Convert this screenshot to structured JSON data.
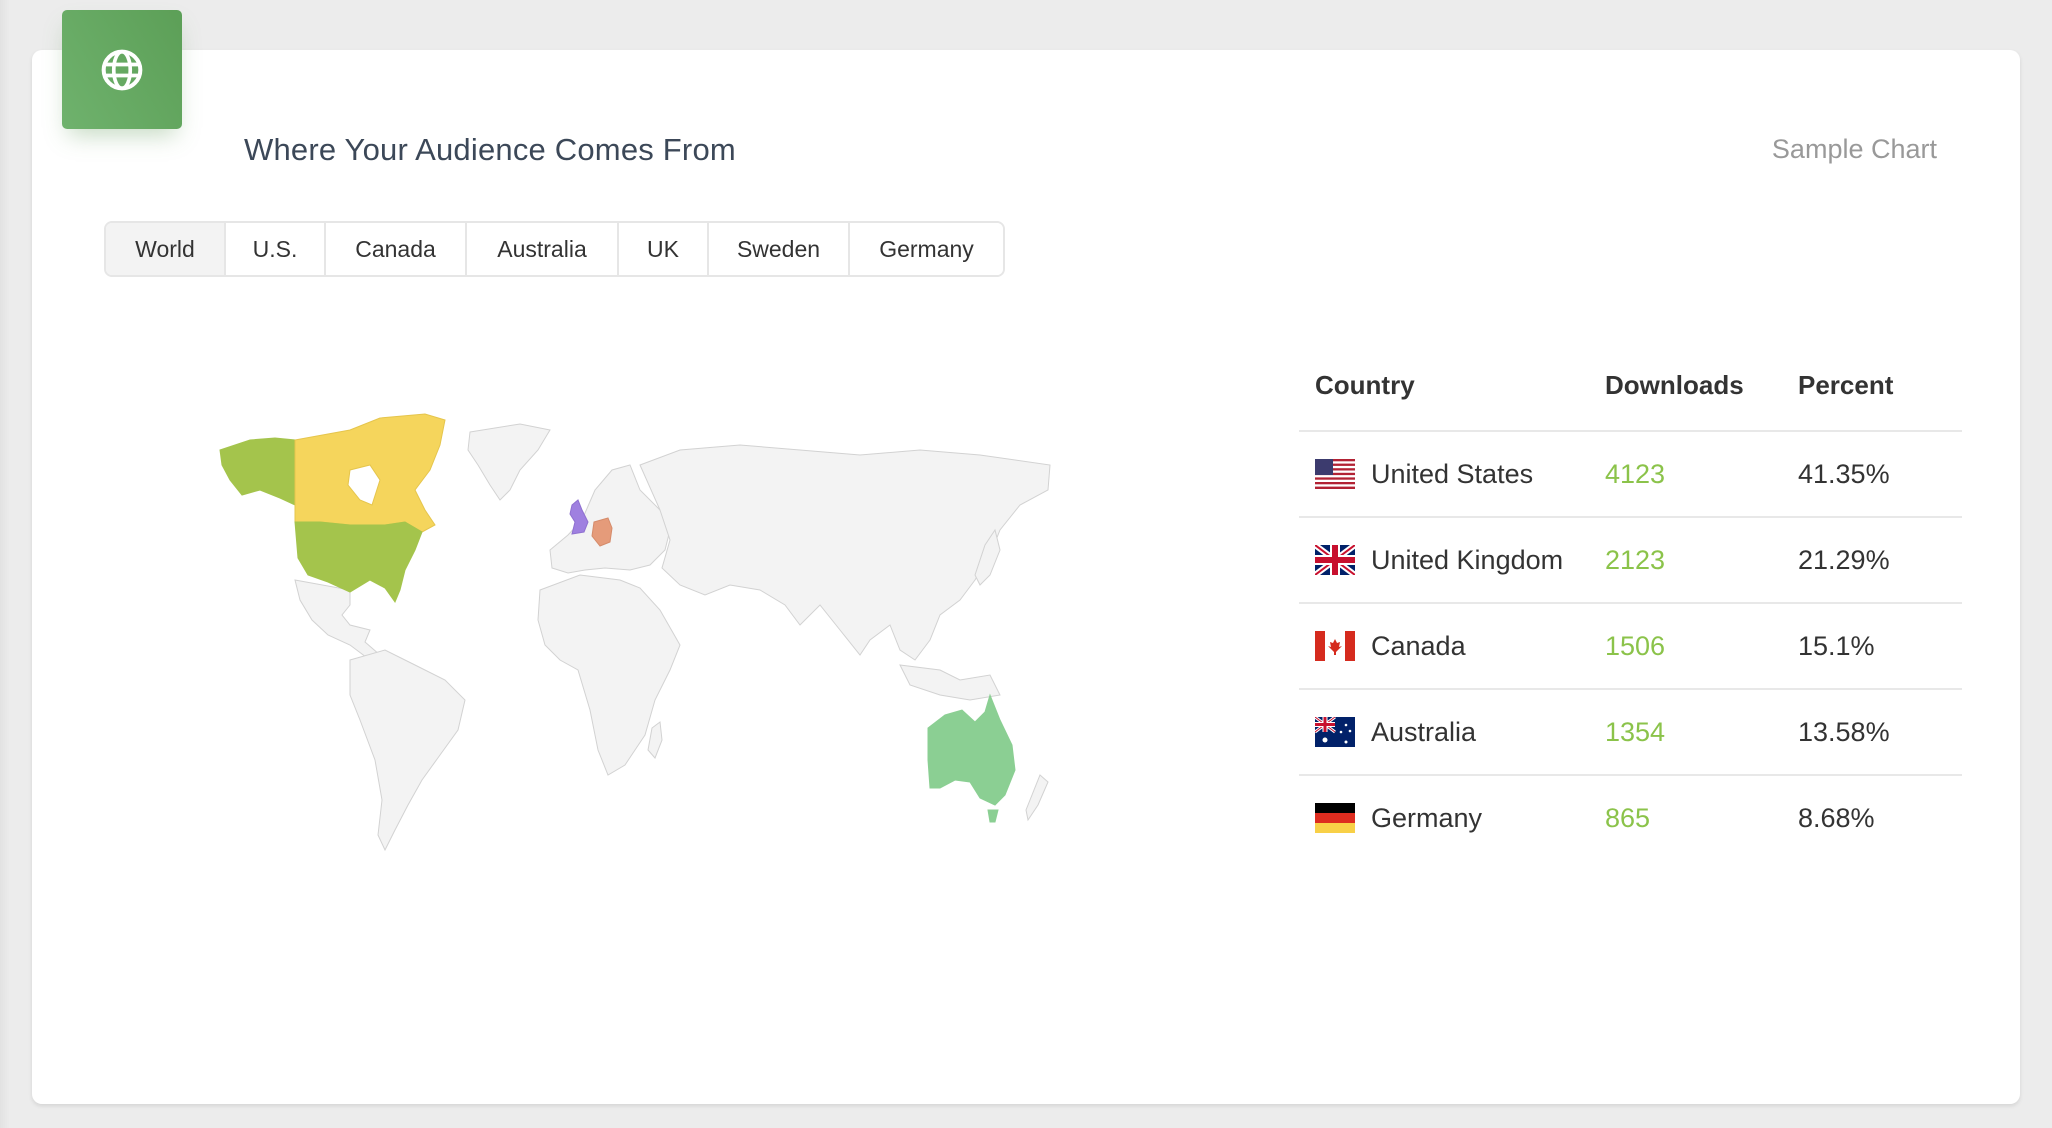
{
  "header": {
    "icon": "globe-icon",
    "title": "Where Your Audience Comes From",
    "subtitle": "Sample Chart",
    "accent_color": "#66aa62"
  },
  "tabs": [
    {
      "label": "World",
      "active": true
    },
    {
      "label": "U.S.",
      "active": false
    },
    {
      "label": "Canada",
      "active": false
    },
    {
      "label": "Australia",
      "active": false
    },
    {
      "label": "UK",
      "active": false
    },
    {
      "label": "Sweden",
      "active": false
    },
    {
      "label": "Germany",
      "active": false
    }
  ],
  "map": {
    "highlighted": [
      {
        "country": "United States",
        "color": "#a4c44c"
      },
      {
        "country": "Canada",
        "color": "#f5d55c"
      },
      {
        "country": "United Kingdom",
        "color": "#9f80e0"
      },
      {
        "country": "Germany",
        "color": "#e59b7a"
      },
      {
        "country": "Australia",
        "color": "#8bcf93"
      }
    ],
    "base_color": "#f3f3f3",
    "border_color": "#d2d2d2"
  },
  "table": {
    "headers": {
      "country": "Country",
      "downloads": "Downloads",
      "percent": "Percent"
    },
    "rows": [
      {
        "flag": "us-flag-icon",
        "country": "United States",
        "downloads": "4123",
        "percent": "41.35%"
      },
      {
        "flag": "uk-flag-icon",
        "country": "United Kingdom",
        "downloads": "2123",
        "percent": "21.29%"
      },
      {
        "flag": "ca-flag-icon",
        "country": "Canada",
        "downloads": "1506",
        "percent": "15.1%"
      },
      {
        "flag": "au-flag-icon",
        "country": "Australia",
        "downloads": "1354",
        "percent": "13.58%"
      },
      {
        "flag": "de-flag-icon",
        "country": "Germany",
        "downloads": "865",
        "percent": "8.68%"
      }
    ],
    "downloads_color": "#8bc34a"
  }
}
